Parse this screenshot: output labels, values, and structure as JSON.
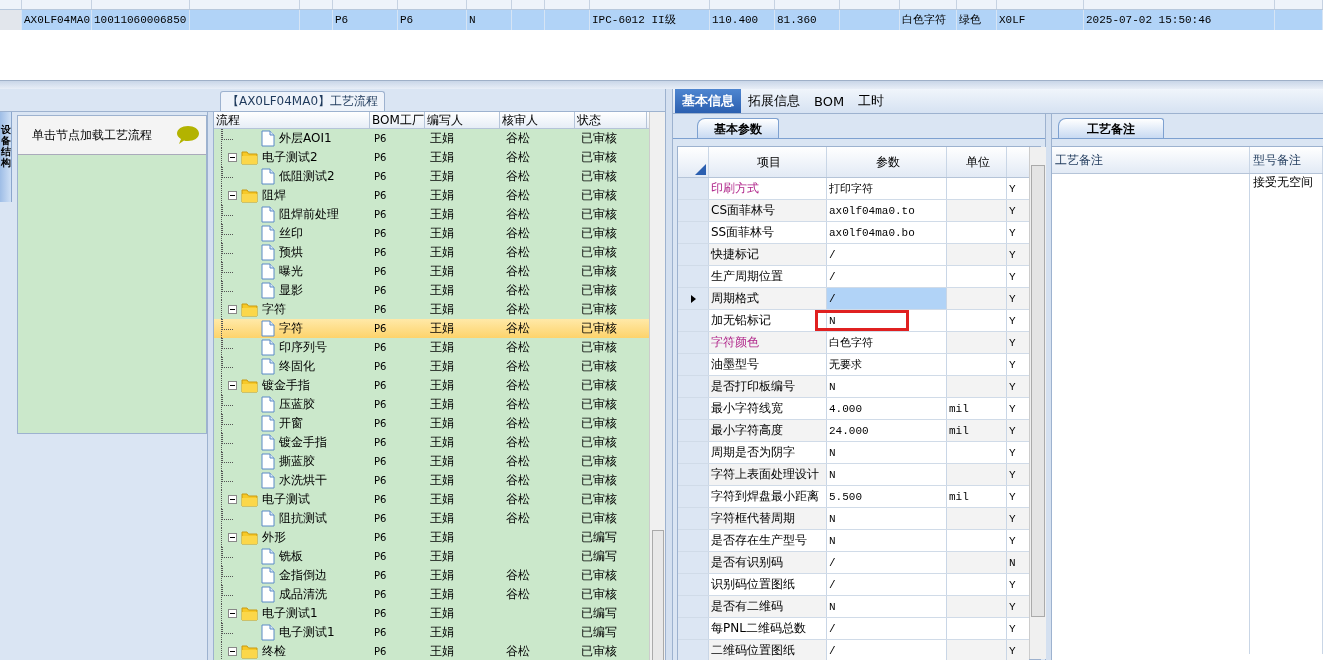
{
  "top_grid": {
    "row": {
      "selected": true,
      "cells": [
        "AX0LF04MA0",
        "10011060006850",
        "P6",
        "P6",
        "N",
        "IPC-6012 II级",
        "110.400",
        "81.360",
        "白色字符",
        "绿色",
        "X0LF",
        "2025-07-02 15:50:46"
      ]
    }
  },
  "side_tab": {
    "label": "设备结构"
  },
  "hint_panel": {
    "text": "单击节点加载工艺流程"
  },
  "flow_panel": {
    "title": "【AX0LF04MA0】工艺流程",
    "columns": [
      "流程",
      "BOM工厂",
      "编写人",
      "核审人",
      "状态"
    ],
    "tree": [
      {
        "expanded": true,
        "children": [
          {
            "name": "外层AOI1",
            "factory": "P6",
            "writer": "王娟",
            "reviewer": "谷松",
            "status": "已审核",
            "selected": false
          }
        ]
      },
      {
        "name": "电子测试2",
        "factory": "P6",
        "writer": "王娟",
        "reviewer": "谷松",
        "status": "已审核",
        "selected": false,
        "expanded": true,
        "children": [
          {
            "name": "低阻测试2",
            "factory": "P6",
            "writer": "王娟",
            "reviewer": "谷松",
            "status": "已审核",
            "selected": false
          }
        ]
      },
      {
        "name": "阻焊",
        "factory": "P6",
        "writer": "王娟",
        "reviewer": "谷松",
        "status": "已审核",
        "selected": false,
        "expanded": true,
        "children": [
          {
            "name": "阻焊前处理",
            "factory": "P6",
            "writer": "王娟",
            "reviewer": "谷松",
            "status": "已审核",
            "selected": false
          },
          {
            "name": "丝印",
            "factory": "P6",
            "writer": "王娟",
            "reviewer": "谷松",
            "status": "已审核",
            "selected": false
          },
          {
            "name": "预烘",
            "factory": "P6",
            "writer": "王娟",
            "reviewer": "谷松",
            "status": "已审核",
            "selected": false
          },
          {
            "name": "曝光",
            "factory": "P6",
            "writer": "王娟",
            "reviewer": "谷松",
            "status": "已审核",
            "selected": false
          },
          {
            "name": "显影",
            "factory": "P6",
            "writer": "王娟",
            "reviewer": "谷松",
            "status": "已审核",
            "selected": false
          }
        ]
      },
      {
        "name": "字符",
        "factory": "P6",
        "writer": "王娟",
        "reviewer": "谷松",
        "status": "已审核",
        "selected": false,
        "expanded": true,
        "children": [
          {
            "name": "字符",
            "factory": "P6",
            "writer": "王娟",
            "reviewer": "谷松",
            "status": "已审核",
            "selected": true
          },
          {
            "name": "印序列号",
            "factory": "P6",
            "writer": "王娟",
            "reviewer": "谷松",
            "status": "已审核",
            "selected": false
          },
          {
            "name": "终固化",
            "factory": "P6",
            "writer": "王娟",
            "reviewer": "谷松",
            "status": "已审核",
            "selected": false
          }
        ]
      },
      {
        "name": "镀金手指",
        "factory": "P6",
        "writer": "王娟",
        "reviewer": "谷松",
        "status": "已审核",
        "selected": false,
        "expanded": true,
        "children": [
          {
            "name": "压蓝胶",
            "factory": "P6",
            "writer": "王娟",
            "reviewer": "谷松",
            "status": "已审核",
            "selected": false
          },
          {
            "name": "开窗",
            "factory": "P6",
            "writer": "王娟",
            "reviewer": "谷松",
            "status": "已审核",
            "selected": false
          },
          {
            "name": "镀金手指",
            "factory": "P6",
            "writer": "王娟",
            "reviewer": "谷松",
            "status": "已审核",
            "selected": false
          },
          {
            "name": "撕蓝胶",
            "factory": "P6",
            "writer": "王娟",
            "reviewer": "谷松",
            "status": "已审核",
            "selected": false
          },
          {
            "name": "水洗烘干",
            "factory": "P6",
            "writer": "王娟",
            "reviewer": "谷松",
            "status": "已审核",
            "selected": false
          }
        ]
      },
      {
        "name": "电子测试",
        "factory": "P6",
        "writer": "王娟",
        "reviewer": "谷松",
        "status": "已审核",
        "selected": false,
        "expanded": true,
        "children": [
          {
            "name": "阻抗测试",
            "factory": "P6",
            "writer": "王娟",
            "reviewer": "谷松",
            "status": "已审核",
            "selected": false
          }
        ]
      },
      {
        "name": "外形",
        "factory": "P6",
        "writer": "王娟",
        "status": "已编写",
        "selected": false,
        "expanded": true,
        "children": [
          {
            "name": "铣板",
            "factory": "P6",
            "writer": "王娟",
            "status": "已编写",
            "selected": false
          },
          {
            "name": "金指倒边",
            "factory": "P6",
            "writer": "王娟",
            "reviewer": "谷松",
            "status": "已审核",
            "selected": false
          },
          {
            "name": "成品清洗",
            "factory": "P6",
            "writer": "王娟",
            "reviewer": "谷松",
            "status": "已审核",
            "selected": false
          }
        ]
      },
      {
        "name": "电子测试1",
        "factory": "P6",
        "writer": "王娟",
        "status": "已编写",
        "selected": false,
        "expanded": true,
        "children": [
          {
            "name": "电子测试1",
            "factory": "P6",
            "writer": "王娟",
            "status": "已编写",
            "selected": false
          }
        ]
      },
      {
        "name": "终检",
        "factory": "P6",
        "writer": "王娟",
        "reviewer": "谷松",
        "status": "已审核",
        "selected": false,
        "expanded": true
      }
    ]
  },
  "tabs": [
    {
      "label": "基本信息",
      "selected": true
    },
    {
      "label": "拓展信息",
      "selected": false
    },
    {
      "label": "BOM",
      "selected": false
    },
    {
      "label": "工时",
      "selected": false
    }
  ],
  "params_panel": {
    "tab": "基本参数",
    "columns": [
      "项目",
      "参数",
      "单位"
    ],
    "rows": [
      {
        "item": "印刷方式",
        "value": "打印字符",
        "flag": "Y",
        "emphasized": true,
        "current": false,
        "marked": false
      },
      {
        "item": "CS面菲林号",
        "value": "ax0lf04ma0.to",
        "flag": "Y",
        "emphasized": false,
        "current": false,
        "marked": false
      },
      {
        "item": "SS面菲林号",
        "value": "ax0lf04ma0.bo",
        "flag": "Y",
        "emphasized": false,
        "current": false,
        "marked": false
      },
      {
        "item": "快捷标记",
        "value": "/",
        "flag": "Y",
        "emphasized": false,
        "current": false,
        "marked": false
      },
      {
        "item": "生产周期位置",
        "value": "/",
        "flag": "Y",
        "emphasized": false,
        "current": false,
        "marked": false
      },
      {
        "item": "周期格式",
        "value": "/",
        "flag": "Y",
        "emphasized": false,
        "current": true,
        "marked": false
      },
      {
        "item": "加无铅标记",
        "value": "N",
        "flag": "Y",
        "emphasized": false,
        "current": false,
        "marked": true
      },
      {
        "item": "字符颜色",
        "value": "白色字符",
        "flag": "Y",
        "emphasized": true,
        "current": false,
        "marked": false
      },
      {
        "item": "油墨型号",
        "value": "无要求",
        "flag": "Y",
        "emphasized": false,
        "current": false,
        "marked": false
      },
      {
        "item": "是否打印板编号",
        "value": "N",
        "flag": "Y",
        "emphasized": false,
        "current": false,
        "marked": false
      },
      {
        "item": "最小字符线宽",
        "value": "4.000",
        "unit": "mil",
        "flag": "Y",
        "emphasized": false,
        "current": false,
        "marked": false
      },
      {
        "item": "最小字符高度",
        "value": "24.000",
        "unit": "mil",
        "flag": "Y",
        "emphasized": false,
        "current": false,
        "marked": false
      },
      {
        "item": "周期是否为阴字",
        "value": "N",
        "flag": "Y",
        "emphasized": false,
        "current": false,
        "marked": false
      },
      {
        "item": "字符上表面处理设计",
        "value": "N",
        "flag": "Y",
        "emphasized": false,
        "current": false,
        "marked": false
      },
      {
        "item": "字符到焊盘最小距离",
        "value": "5.500",
        "unit": "mil",
        "flag": "Y",
        "emphasized": false,
        "current": false,
        "marked": false
      },
      {
        "item": "字符框代替周期",
        "value": "N",
        "flag": "Y",
        "emphasized": false,
        "current": false,
        "marked": false
      },
      {
        "item": "是否存在生产型号",
        "value": "N",
        "flag": "Y",
        "emphasized": false,
        "current": false,
        "marked": false
      },
      {
        "item": "是否有识别码",
        "value": "/",
        "flag": "N",
        "emphasized": false,
        "current": false,
        "marked": false
      },
      {
        "item": "识别码位置图纸",
        "value": "/",
        "flag": "Y",
        "emphasized": false,
        "current": false,
        "marked": false
      },
      {
        "item": "是否有二维码",
        "value": "N",
        "flag": "Y",
        "emphasized": false,
        "current": false,
        "marked": false
      },
      {
        "item": "每PNL二维码总数",
        "value": "/",
        "flag": "Y",
        "emphasized": false,
        "current": false,
        "marked": false
      },
      {
        "item": "二维码位置图纸",
        "value": "/",
        "flag": "Y",
        "emphasized": false,
        "current": false,
        "marked": false
      }
    ]
  },
  "notes_panel": {
    "tab": "工艺备注",
    "columns": [
      "工艺备注",
      "型号备注"
    ],
    "model_note": "接受无空间"
  }
}
